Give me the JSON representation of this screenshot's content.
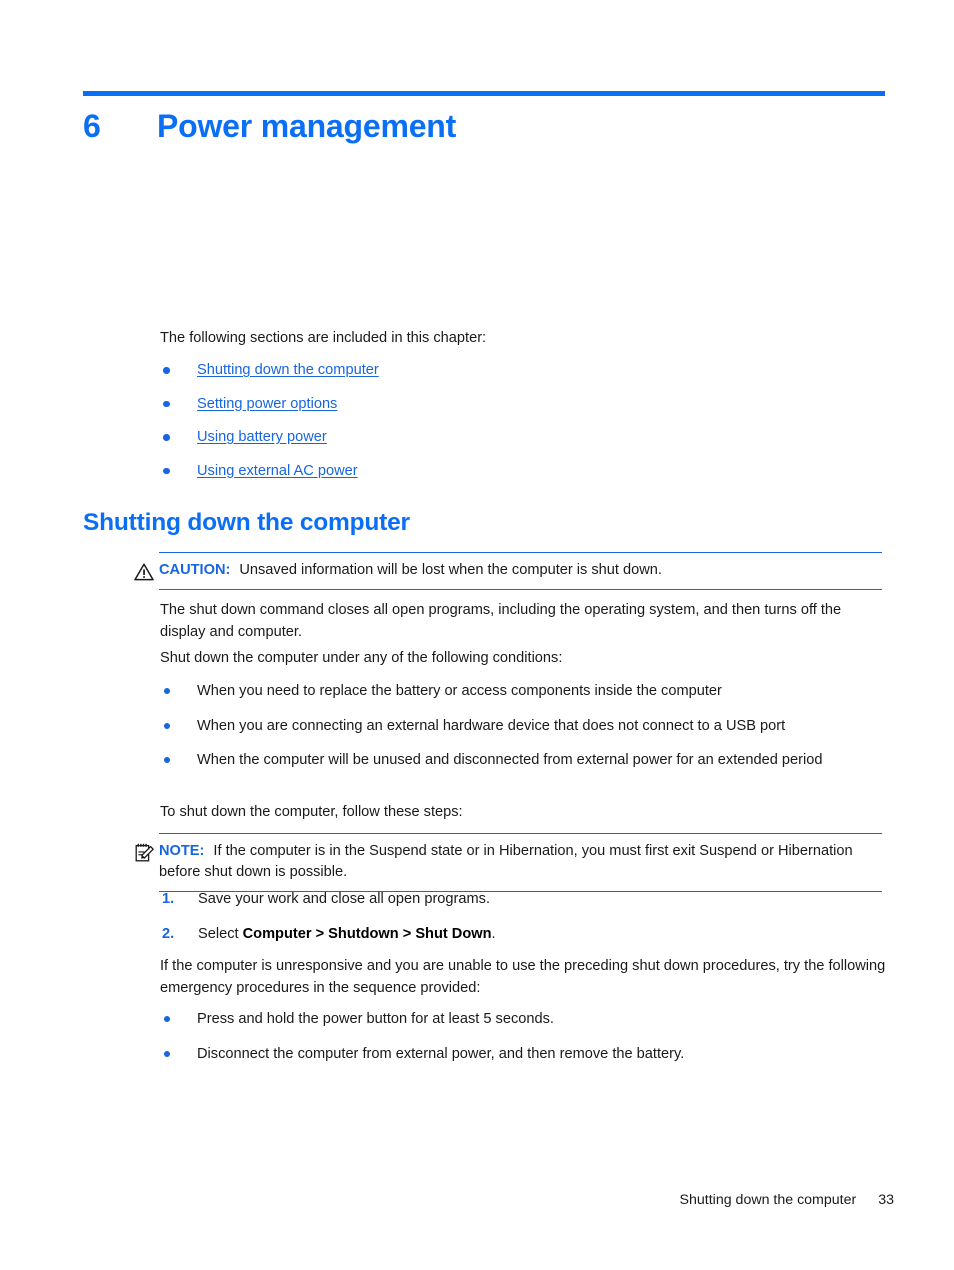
{
  "document": {
    "chapter_number": "6",
    "chapter_title": "Power management",
    "intro_text": "The following sections are included in this chapter:",
    "accent_color": "#0b6ff5",
    "link_color": "#1766e0"
  },
  "toc": {
    "items": [
      {
        "label": "Shutting down the computer"
      },
      {
        "label": "Setting power options"
      },
      {
        "label": "Using battery power"
      },
      {
        "label": "Using external AC power"
      }
    ]
  },
  "section": {
    "heading": "Shutting down the computer",
    "caution": {
      "icon": "warning-triangle-icon",
      "label": "CAUTION:",
      "text": "Unsaved information will be lost when the computer is shut down."
    },
    "paragraph_description": "The shut down command closes all open programs, including the operating system, and then turns off the display and computer.",
    "paragraph_conditions_intro": "Shut down the computer under any of the following conditions:",
    "conditions": [
      {
        "text": "When you need to replace the battery or access components inside the computer"
      },
      {
        "text": "When you are connecting an external hardware device that does not connect to a USB port"
      },
      {
        "text": "When the computer will be unused and disconnected from external power for an extended period"
      }
    ],
    "paragraph_steps_intro": "To shut down the computer, follow these steps:",
    "note": {
      "icon": "notepad-pencil-icon",
      "label": "NOTE:",
      "text": "If the computer is in the Suspend state or in Hibernation, you must first exit Suspend or Hibernation before shut down is possible."
    },
    "steps": [
      {
        "number": "1.",
        "text": "Save your work and close all open programs."
      },
      {
        "number": "2.",
        "text_before": "Select ",
        "text_bold": "Computer > Shutdown > Shut Down",
        "text_after": "."
      }
    ],
    "paragraph_unresponsive": "If the computer is unresponsive and you are unable to use the preceding shut down procedures, try the following emergency procedures in the sequence provided:",
    "emergency": [
      {
        "text": "Press and hold the power button for at least 5 seconds."
      },
      {
        "text": "Disconnect the computer from external power, and then remove the battery."
      }
    ]
  },
  "footer": {
    "section_name": "Shutting down the computer",
    "page_number": "33"
  }
}
